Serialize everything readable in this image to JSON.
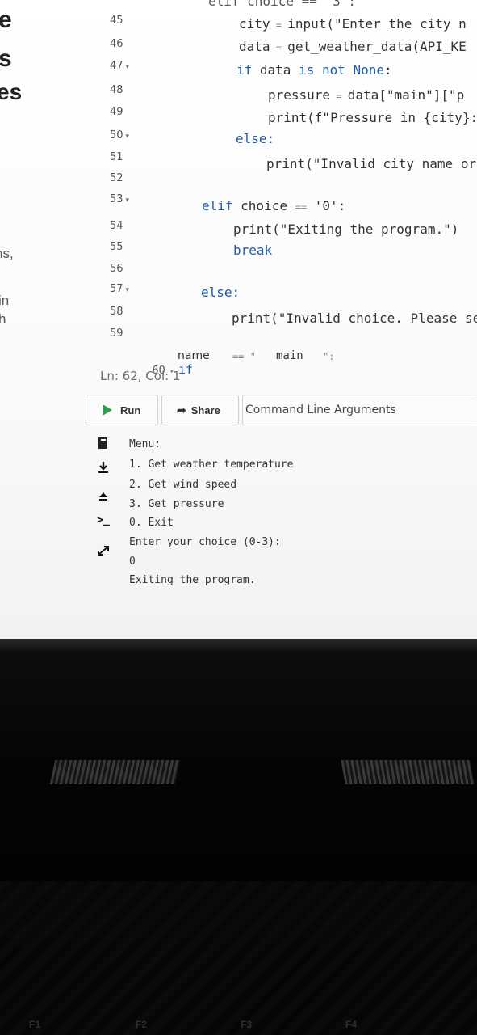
{
  "sidebar_fragments": [
    "e",
    "s",
    "es",
    "ns,",
    "in",
    "h"
  ],
  "line_numbers": [
    {
      "n": "45",
      "fold": false
    },
    {
      "n": "46",
      "fold": false
    },
    {
      "n": "47",
      "fold": true
    },
    {
      "n": "48",
      "fold": false
    },
    {
      "n": "49",
      "fold": false
    },
    {
      "n": "50",
      "fold": true
    },
    {
      "n": "51",
      "fold": false
    },
    {
      "n": "52",
      "fold": false
    },
    {
      "n": "53",
      "fold": true
    },
    {
      "n": "54",
      "fold": false
    },
    {
      "n": "55",
      "fold": false
    },
    {
      "n": "56",
      "fold": false
    },
    {
      "n": "57",
      "fold": true
    },
    {
      "n": "58",
      "fold": false
    },
    {
      "n": "59",
      "fold": false
    }
  ],
  "code": {
    "top_partial": "elif choice == '3':",
    "l45": {
      "a": "city",
      "b": " = ",
      "c": "input(\"Enter the city n"
    },
    "l46": {
      "a": "data",
      "b": " = ",
      "c": "get_weather_data(API_KE"
    },
    "l47": {
      "kw1": "if",
      "mid": " data ",
      "kw2": "is not None",
      "end": ":"
    },
    "l48": {
      "a": "pressure",
      "b": " = ",
      "c": "data[\"main\"][\"p"
    },
    "l49": "print(f\"Pressure in {city}:",
    "l50": "else:",
    "l51": "print(\"Invalid city name or",
    "l53": {
      "kw": "elif",
      "mid": " choice ",
      "op": "==",
      "str": " '0':"
    },
    "l54": "print(\"Exiting the program.\")",
    "l55": "break",
    "l57": "else:",
    "l58": "print(\"Invalid choice. Please se",
    "l60": {
      "num": "60",
      "kw": "if",
      "name": "name",
      "op": "== \"",
      "main": "main",
      "end": "\":"
    }
  },
  "status_bar": "Ln: 62, Col: 1",
  "toolbar": {
    "run_label": "Run",
    "share_label": "Share",
    "args_label": "Command Line Arguments"
  },
  "side_icons": [
    "file-icon",
    "download-icon",
    "erase-icon",
    "terminal-icon",
    "expand-icon"
  ],
  "console_lines": [
    "Menu:",
    "1. Get weather temperature",
    "2. Get wind speed",
    "3. Get pressure",
    "0. Exit",
    "Enter your choice (0-3):",
    "0",
    "Exiting the program."
  ],
  "keyboard_keys": [
    "F1",
    "F2",
    "F3",
    "F4"
  ]
}
